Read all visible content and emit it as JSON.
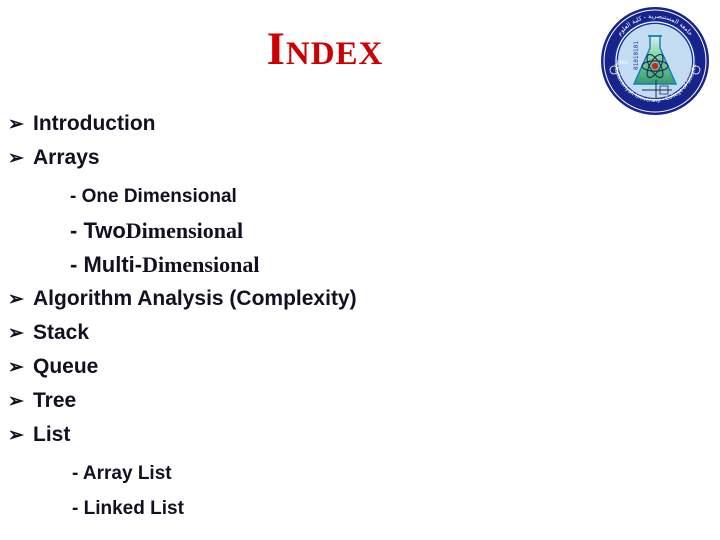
{
  "slide": {
    "title": "Index",
    "background_color": "#ffffff",
    "title_color": "#CC0000",
    "text_color": "#111122",
    "bullet_glyph": "➢"
  },
  "logo": {
    "name": "university-seal",
    "ring_color": "#1a2f9e",
    "inner_color": "#bcd9f2",
    "flask_color": "#2fb36b",
    "nucleus_color": "#cc2222",
    "arabic_text": "جامعة المستنصرية - كلية العلوم",
    "english_text": "Mustansiriyah University - College of Science",
    "binary_text": "01010101",
    "year_text": "1963"
  },
  "index": {
    "items": [
      {
        "type": "bullet",
        "label": "Introduction"
      },
      {
        "type": "bullet",
        "label": "Arrays"
      },
      {
        "type": "sub",
        "label": "- One Dimensional"
      },
      {
        "type": "sub_mixed",
        "prefix": "- Two ",
        "serif": "Dimensional"
      },
      {
        "type": "sub_mixed",
        "prefix": "- Multi-",
        "serif": "Dimensional"
      },
      {
        "type": "bullet",
        "label": "Algorithm Analysis (Complexity)"
      },
      {
        "type": "bullet",
        "label": "Stack"
      },
      {
        "type": "bullet",
        "label": "Queue"
      },
      {
        "type": "bullet",
        "label": "Tree"
      },
      {
        "type": "bullet",
        "label": "List"
      },
      {
        "type": "sub",
        "label": "- Array List"
      },
      {
        "type": "sub",
        "label": "- Linked List"
      }
    ],
    "labels": {
      "introduction": "Introduction",
      "arrays": "Arrays",
      "one_dimensional": "- One Dimensional",
      "two_prefix": "- Two ",
      "two_serif": "Dimensional",
      "multi_prefix": "- Multi-",
      "multi_serif": "Dimensional",
      "algorithm_analysis": "Algorithm Analysis (Complexity)",
      "stack": "Stack",
      "queue": "Queue",
      "tree": "Tree",
      "list": "List",
      "array_list": "- Array List",
      "linked_list": "- Linked List"
    },
    "bullets": {
      "b1": "➢",
      "b2": "➢",
      "b3": "➢",
      "b4": "➢",
      "b5": "➢",
      "b6": "➢",
      "b7": "➢"
    }
  }
}
